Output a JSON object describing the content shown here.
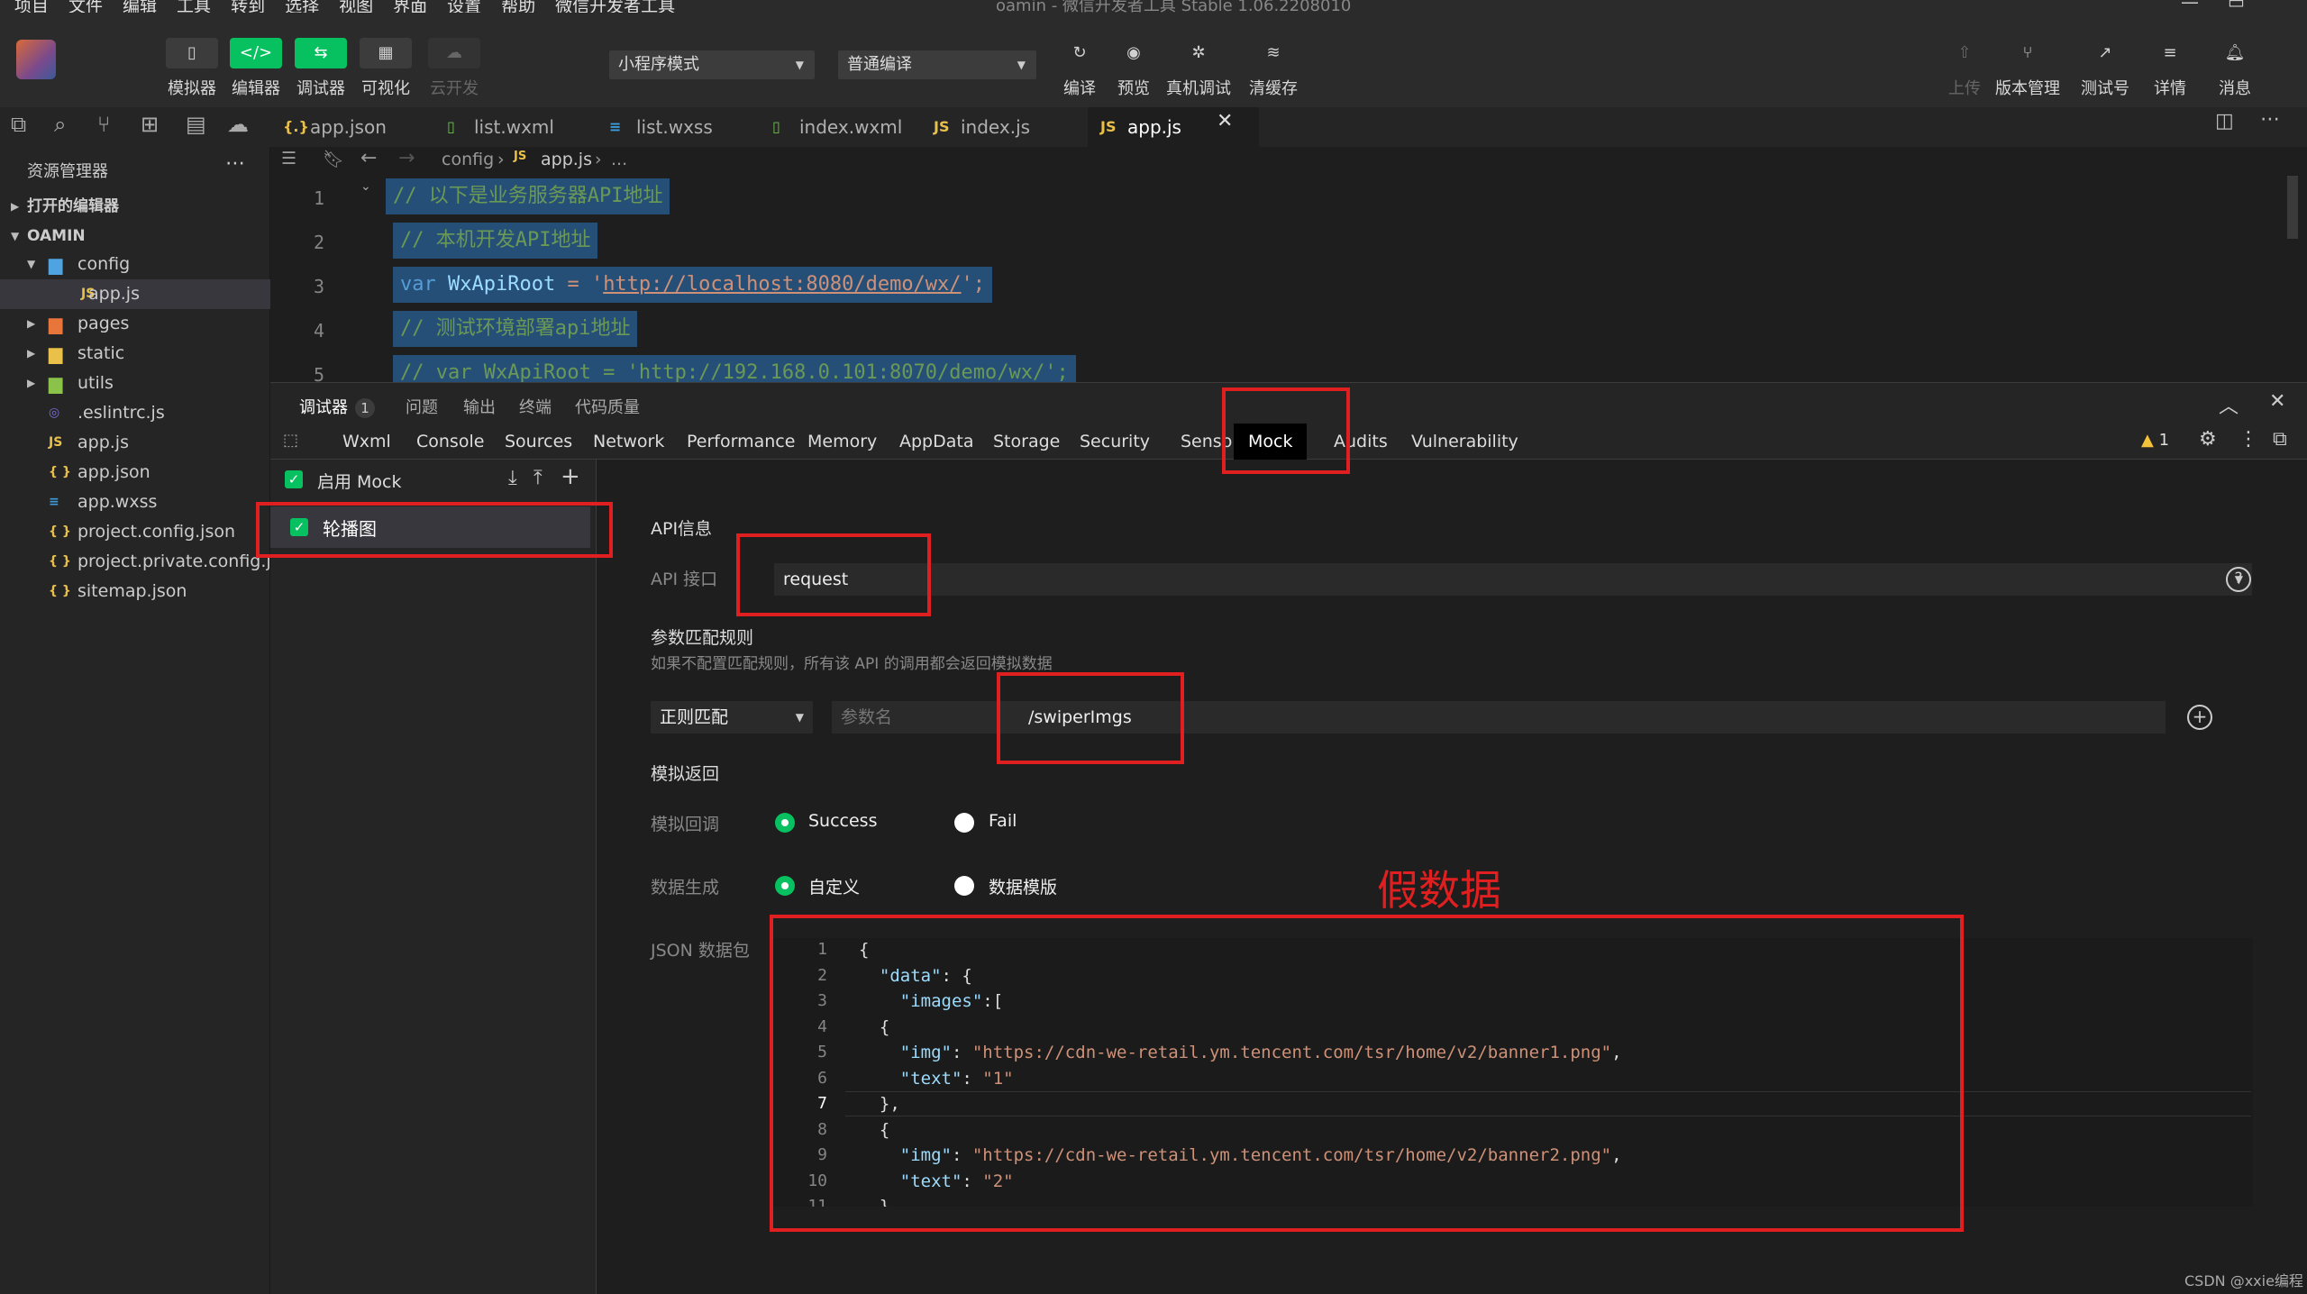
{
  "menubar": {
    "items": [
      "项目",
      "文件",
      "编辑",
      "工具",
      "转到",
      "选择",
      "视图",
      "界面",
      "设置",
      "帮助",
      "微信开发者工具"
    ],
    "window_title": "oamin - 微信开发者工具 Stable 1.06.2208010"
  },
  "toolbar": {
    "left_tools": [
      {
        "label": "模拟器",
        "icon": "phone-icon"
      },
      {
        "label": "编辑器",
        "icon": "code-icon"
      },
      {
        "label": "调试器",
        "icon": "debug-icon"
      },
      {
        "label": "可视化",
        "icon": "layout-icon"
      },
      {
        "label": "云开发",
        "icon": "cloud-icon"
      }
    ],
    "mode_select": "小程序模式",
    "compile_select": "普通编译",
    "mid_tools": [
      {
        "label": "编译",
        "icon": "refresh-icon"
      },
      {
        "label": "预览",
        "icon": "eye-icon"
      },
      {
        "label": "真机调试",
        "icon": "bug-icon"
      },
      {
        "label": "清缓存",
        "icon": "layers-icon"
      }
    ],
    "right_tools": [
      {
        "label": "上传",
        "icon": "upload-icon"
      },
      {
        "label": "版本管理",
        "icon": "branch-icon"
      },
      {
        "label": "测试号",
        "icon": "external-icon"
      },
      {
        "label": "详情",
        "icon": "menu-icon"
      },
      {
        "label": "消息",
        "icon": "bell-icon"
      }
    ]
  },
  "editor_tabs": [
    {
      "label": "app.json",
      "icon": "{.}",
      "color": "#e8c04a"
    },
    {
      "label": "list.wxml",
      "icon": "▯",
      "color": "#6cc24a"
    },
    {
      "label": "list.wxss",
      "icon": "≡",
      "color": "#3b9cd9"
    },
    {
      "label": "index.wxml",
      "icon": "▯",
      "color": "#6cc24a"
    },
    {
      "label": "index.js",
      "icon": "JS",
      "color": "#e8c04a"
    },
    {
      "label": "app.js",
      "icon": "JS",
      "color": "#e8c04a",
      "active": true
    }
  ],
  "sidebar": {
    "title": "资源管理器",
    "sections": [
      {
        "label": "打开的编辑器",
        "expanded": false
      },
      {
        "label": "OAMIN",
        "expanded": true
      }
    ],
    "tree": [
      {
        "label": "config",
        "type": "folder",
        "expanded": true,
        "color": "#4fa3e0"
      },
      {
        "label": "app.js",
        "type": "js",
        "selected": true
      },
      {
        "label": "pages",
        "type": "folder",
        "color": "#e8763a"
      },
      {
        "label": "static",
        "type": "folder",
        "color": "#e8c04a"
      },
      {
        "label": "utils",
        "type": "folder",
        "color": "#8bc34a"
      },
      {
        "label": ".eslintrc.js",
        "type": "eslint"
      },
      {
        "label": "app.js",
        "type": "js"
      },
      {
        "label": "app.json",
        "type": "json"
      },
      {
        "label": "app.wxss",
        "type": "wxss"
      },
      {
        "label": "project.config.json",
        "type": "json"
      },
      {
        "label": "project.private.config.js...",
        "type": "json"
      },
      {
        "label": "sitemap.json",
        "type": "json"
      }
    ]
  },
  "breadcrumb": {
    "parts": [
      "config",
      "app.js",
      "..."
    ]
  },
  "code": {
    "line_numbers": [
      "1",
      "2",
      "3",
      "4",
      "5"
    ],
    "lines": [
      {
        "parts": [
          {
            "t": "// 以下是业务服务器API地址",
            "c": "cm"
          }
        ]
      },
      {
        "parts": [
          {
            "t": "// 本机开发API地址",
            "c": "cm"
          }
        ]
      },
      {
        "parts": [
          {
            "t": "var ",
            "c": "kw"
          },
          {
            "t": "WxApiRoot",
            "c": "vr"
          },
          {
            "t": " = '",
            "c": "st"
          },
          {
            "t": "http://localhost:8080/demo/wx/",
            "c": "st"
          },
          {
            "t": "';",
            "c": "st"
          }
        ]
      },
      {
        "parts": [
          {
            "t": "// 测试环境部署api地址",
            "c": "cm"
          }
        ]
      },
      {
        "parts": [
          {
            "t": "// var WxApiRoot = 'http://192.168.0.101:8070/demo/wx/';",
            "c": "cm"
          }
        ]
      }
    ]
  },
  "devtools": {
    "top_tabs": [
      "调试器",
      "问题",
      "输出",
      "终端",
      "代码质量"
    ],
    "debugger_badge": "1",
    "panel_tabs": [
      "Wxml",
      "Console",
      "Sources",
      "Network",
      "Performance",
      "Memory",
      "AppData",
      "Storage",
      "Security",
      "Sensor",
      "Mock",
      "Audits",
      "Vulnerability"
    ],
    "active_panel": "Mock",
    "warning_count": "1"
  },
  "mock": {
    "enable_label": "启用 Mock",
    "rules": [
      {
        "label": "轮播图",
        "checked": true
      }
    ],
    "api_section": "API信息",
    "api_label": "API 接口",
    "api_value": "request",
    "param_section": "参数匹配规则",
    "param_hint": "如果不配置匹配规则，所有该 API 的调用都会返回模拟数据",
    "match_type": "正则匹配",
    "param_name_placeholder": "参数名",
    "param_value": "/swiperImgs",
    "return_section": "模拟返回",
    "callback_label": "模拟回调",
    "callback_success": "Success",
    "callback_fail": "Fail",
    "gen_label": "数据生成",
    "gen_custom": "自定义",
    "gen_template": "数据模版",
    "json_label": "JSON 数据包",
    "json_line_numbers": [
      "1",
      "2",
      "3",
      "4",
      "5",
      "6",
      "7",
      "8",
      "9",
      "10",
      "11"
    ],
    "json_lines": [
      {
        "parts": [
          {
            "t": "{",
            "c": ""
          }
        ]
      },
      {
        "parts": [
          {
            "t": "  ",
            "c": ""
          },
          {
            "t": "\"data\"",
            "c": "jk"
          },
          {
            "t": ": {",
            "c": ""
          }
        ]
      },
      {
        "parts": [
          {
            "t": "    ",
            "c": ""
          },
          {
            "t": "\"images\"",
            "c": "jk"
          },
          {
            "t": ":[",
            "c": ""
          }
        ]
      },
      {
        "parts": [
          {
            "t": "  {",
            "c": ""
          }
        ]
      },
      {
        "parts": [
          {
            "t": "    ",
            "c": ""
          },
          {
            "t": "\"img\"",
            "c": "jk"
          },
          {
            "t": ": ",
            "c": ""
          },
          {
            "t": "\"https://cdn-we-retail.ym.tencent.com/tsr/home/v2/banner1.png\"",
            "c": "js"
          },
          {
            "t": ",",
            "c": ""
          }
        ]
      },
      {
        "parts": [
          {
            "t": "    ",
            "c": ""
          },
          {
            "t": "\"text\"",
            "c": "jk"
          },
          {
            "t": ": ",
            "c": ""
          },
          {
            "t": "\"1\"",
            "c": "js"
          }
        ]
      },
      {
        "parts": [
          {
            "t": "  },",
            "c": ""
          }
        ]
      },
      {
        "parts": [
          {
            "t": "  {",
            "c": ""
          }
        ]
      },
      {
        "parts": [
          {
            "t": "    ",
            "c": ""
          },
          {
            "t": "\"img\"",
            "c": "jk"
          },
          {
            "t": ": ",
            "c": ""
          },
          {
            "t": "\"https://cdn-we-retail.ym.tencent.com/tsr/home/v2/banner2.png\"",
            "c": "js"
          },
          {
            "t": ",",
            "c": ""
          }
        ]
      },
      {
        "parts": [
          {
            "t": "    ",
            "c": ""
          },
          {
            "t": "\"text\"",
            "c": "jk"
          },
          {
            "t": ": ",
            "c": ""
          },
          {
            "t": "\"2\"",
            "c": "js"
          }
        ]
      },
      {
        "parts": [
          {
            "t": "  }",
            "c": ""
          }
        ]
      }
    ]
  },
  "annotation": {
    "text": "假数据",
    "color": "#e02020"
  },
  "watermark": "CSDN @xxie编程",
  "colors": {
    "accent_green": "#07c160",
    "highlight_red": "#e02020",
    "selection": "#264f78"
  }
}
